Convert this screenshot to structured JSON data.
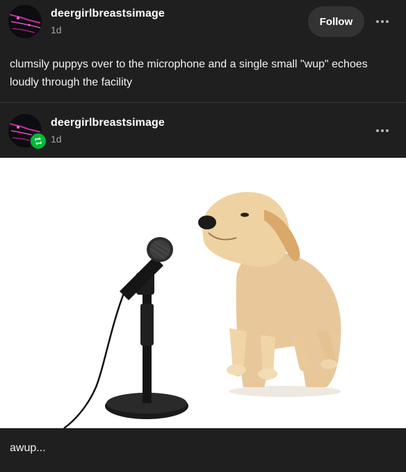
{
  "post": {
    "username": "deergirlbreastsimage",
    "time": "1d",
    "follow_label": "Follow",
    "text": "clumsily puppys over to the microphone and a single small \"wup\" echoes loudly through the facility"
  },
  "reblog": {
    "username": "deergirlbreastsimage",
    "time": "1d",
    "caption": "awup..."
  },
  "colors": {
    "background": "#1f1f1f",
    "reblog_badge": "#00b83a",
    "follow_button": "#333333"
  },
  "icons": [
    "avatar",
    "more-icon",
    "reblog-icon"
  ]
}
